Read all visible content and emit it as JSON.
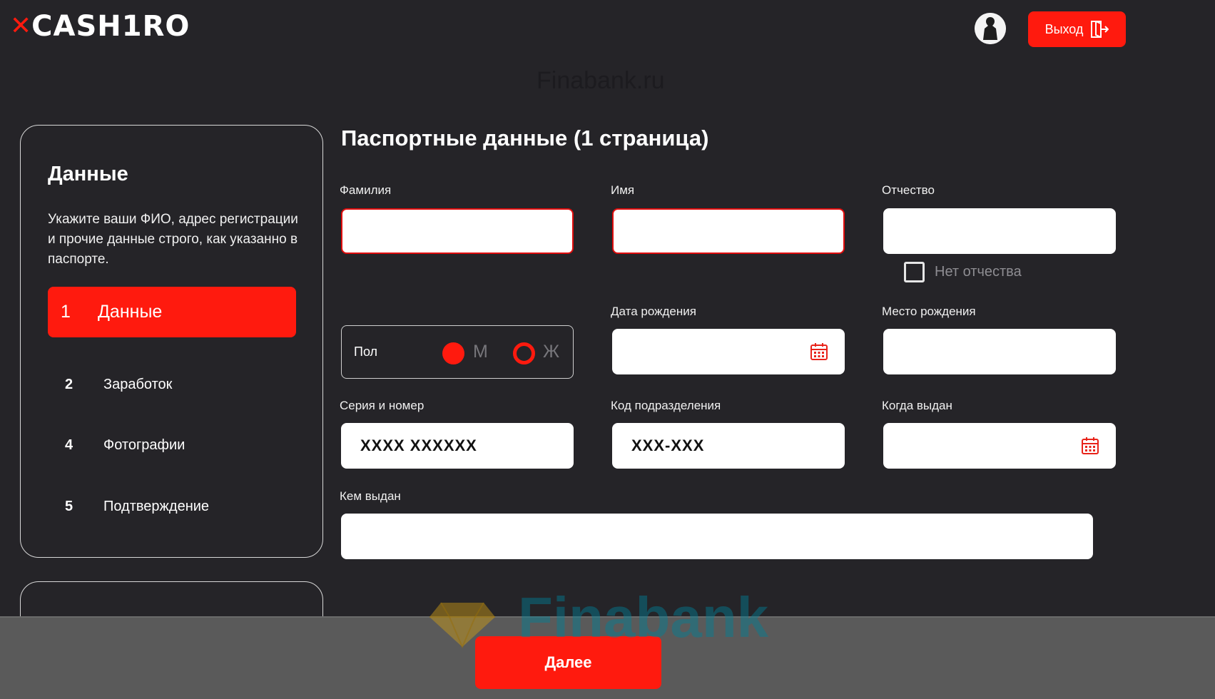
{
  "header": {
    "logo_mark": "✕",
    "logo_text": "CASH1RO",
    "exit_label": "Выход",
    "watermark_top": "Finabank.ru"
  },
  "sidebar": {
    "title": "Данные",
    "description": "Укажите ваши ФИО, адрес регистрации и прочие данные строго, как указанно в паспорте.",
    "steps": [
      {
        "num": "1",
        "label": "Данные",
        "active": true
      },
      {
        "num": "2",
        "label": "Заработок",
        "active": false
      },
      {
        "num": "4",
        "label": "Фотографии",
        "active": false
      },
      {
        "num": "5",
        "label": "Подтверждение",
        "active": false
      }
    ]
  },
  "form": {
    "title": "Паспортные данные (1 страница)",
    "fields": {
      "last_name": {
        "label": "Фамилия",
        "value": ""
      },
      "first_name": {
        "label": "Имя",
        "value": ""
      },
      "patronymic": {
        "label": "Отчество",
        "value": ""
      },
      "no_patronymic": "Нет отчества",
      "gender": {
        "label": "Пол",
        "options": [
          "М",
          "Ж"
        ],
        "selected": "М"
      },
      "birth_date": {
        "label": "Дата рождения",
        "value": ""
      },
      "birth_place": {
        "label": "Место рождения",
        "value": ""
      },
      "series_number": {
        "label": "Серия и номер",
        "value": "XXXX XXXXXX"
      },
      "department_code": {
        "label": "Код подразделения",
        "value": "XXX-XXX"
      },
      "issue_date": {
        "label": "Когда выдан",
        "value": ""
      },
      "issued_by": {
        "label": "Кем выдан",
        "value": ""
      }
    }
  },
  "footer": {
    "next_label": "Далее",
    "watermark": "Finabank"
  },
  "colors": {
    "accent": "#ff1a0e",
    "background": "#252428",
    "bottom_bar": "#5a5a5a"
  }
}
